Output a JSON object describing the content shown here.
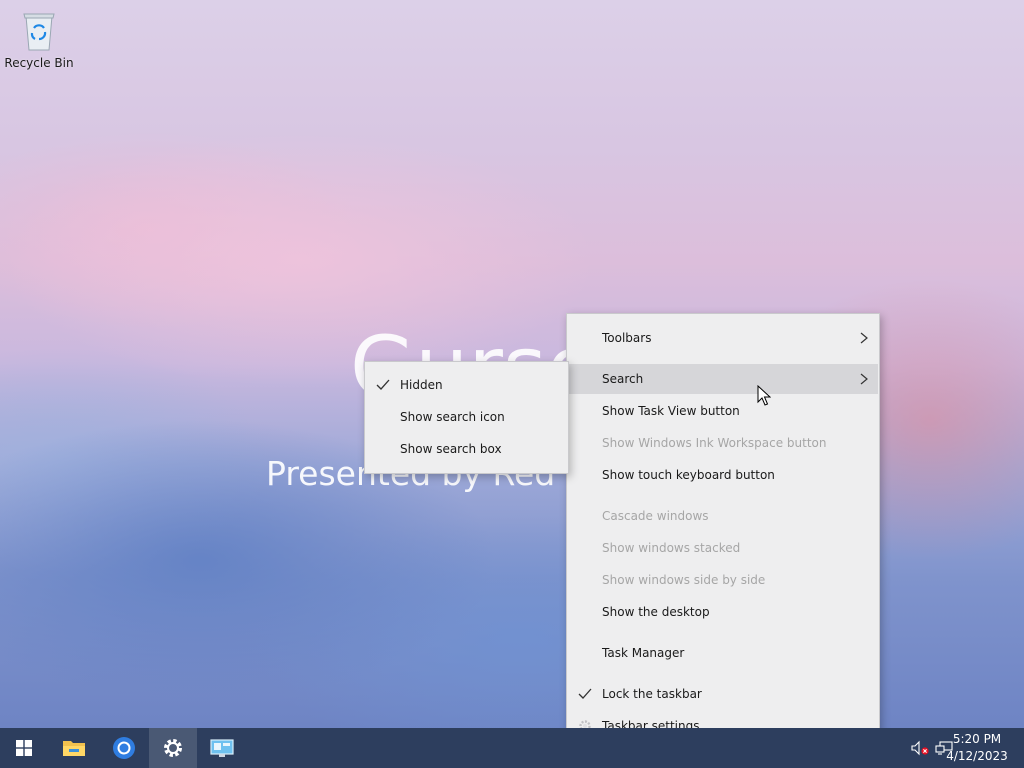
{
  "desktop": {
    "recycle_bin_label": "Recycle Bin",
    "wallpaper_title": "Gurso",
    "wallpaper_subtitle": "Presented by Red"
  },
  "context_menu": {
    "items": [
      {
        "label": "Toolbars",
        "has_submenu": true,
        "enabled": true
      },
      {
        "label": "Search",
        "has_submenu": true,
        "enabled": true,
        "highlighted": true
      },
      {
        "label": "Show Task View button",
        "enabled": true
      },
      {
        "label": "Show Windows Ink Workspace button",
        "enabled": false
      },
      {
        "label": "Show touch keyboard button",
        "enabled": true
      },
      {
        "label": "Cascade windows",
        "enabled": false
      },
      {
        "label": "Show windows stacked",
        "enabled": false
      },
      {
        "label": "Show windows side by side",
        "enabled": false
      },
      {
        "label": "Show the desktop",
        "enabled": true
      },
      {
        "label": "Task Manager",
        "enabled": true
      },
      {
        "label": "Lock the taskbar",
        "enabled": true,
        "checked": true
      },
      {
        "label": "Taskbar settings",
        "enabled": true,
        "icon": "gear-icon"
      }
    ]
  },
  "search_submenu": {
    "items": [
      {
        "label": "Hidden",
        "checked": true
      },
      {
        "label": "Show search icon",
        "checked": false
      },
      {
        "label": "Show search box",
        "checked": false
      }
    ]
  },
  "taskbar": {
    "apps": [
      {
        "name": "start-button",
        "icon": "windows-logo-icon"
      },
      {
        "name": "file-explorer",
        "icon": "folder-icon"
      },
      {
        "name": "chromium-browser",
        "icon": "browser-icon"
      },
      {
        "name": "settings",
        "icon": "gear-icon",
        "active": true
      },
      {
        "name": "control-panel",
        "icon": "monitor-icon"
      }
    ],
    "tray": {
      "volume_icon": "volume-muted-icon",
      "network_icon": "network-icon",
      "time": "5:20 PM",
      "date": "4/12/2023"
    }
  },
  "colors": {
    "taskbar_bg": "#2d3e5e",
    "menu_bg": "#eeeeef",
    "menu_highlight": "#d6d6d9",
    "disabled_text": "#a6a6a6",
    "muted_badge": "#e81123"
  }
}
